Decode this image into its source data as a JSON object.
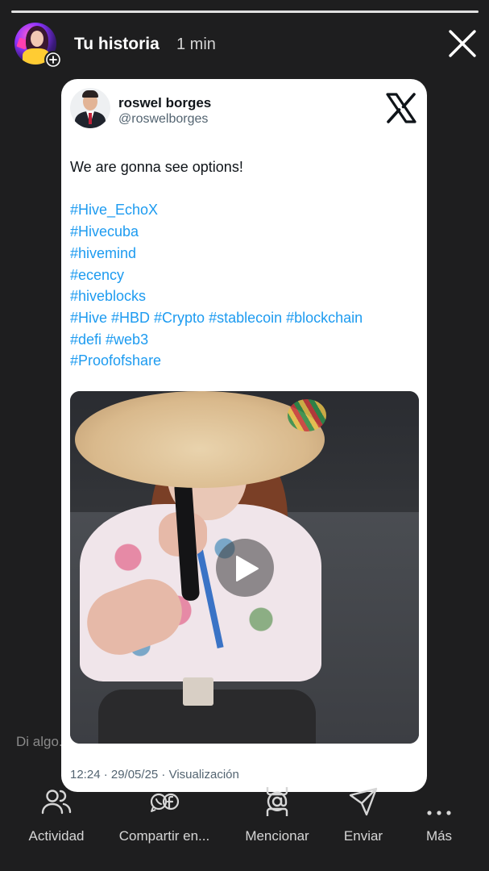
{
  "story": {
    "title": "Tu historia",
    "time": "1 min",
    "progress": 1.0,
    "reply_placeholder": "Di algo..."
  },
  "post": {
    "author_name": "roswel borges",
    "author_handle": "@roswelborges",
    "text": "We are gonna see options!",
    "hashtag_lines": [
      "#Hive_EchoX",
      "#Hivecuba",
      "#hivemind",
      "#ecency",
      "#hiveblocks",
      "#Hive #HBD #Crypto #stablecoin #blockchain",
      "#defi #web3",
      "#Proofofshare"
    ],
    "meta": "12:24 · 29/05/25 · Visualización",
    "media_type": "video"
  },
  "actions": [
    {
      "label": "Actividad",
      "icon": "people-icon"
    },
    {
      "label": "Compartir en...",
      "icon": "share-apps-icon"
    },
    {
      "label": "Mencionar",
      "icon": "mention-icon"
    },
    {
      "label": "Enviar",
      "icon": "send-icon"
    },
    {
      "label": "Más",
      "icon": "more-icon"
    }
  ],
  "colors": {
    "background": "#1e1e1f",
    "hashtag": "#1d9bf0",
    "muted_text": "#536471"
  }
}
